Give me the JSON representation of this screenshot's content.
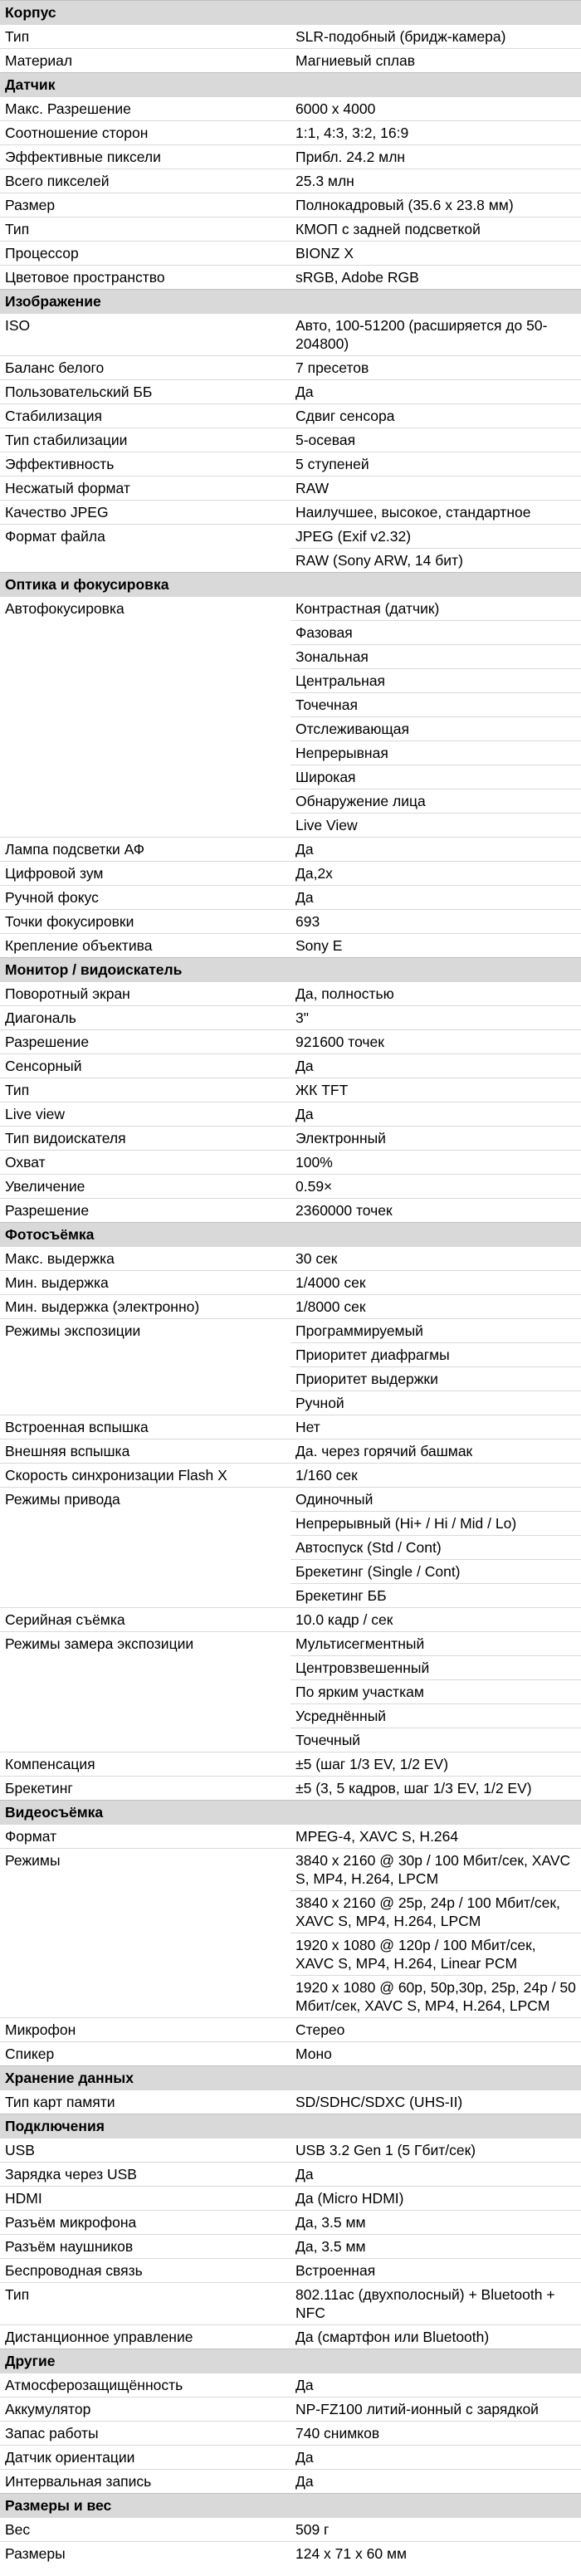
{
  "sections": [
    {
      "title": "Корпус",
      "rows": [
        {
          "label": "Тип",
          "value": "SLR-подобный (бридж-камера)"
        },
        {
          "label": "Материал",
          "value": "Магниевый сплав"
        }
      ]
    },
    {
      "title": "Датчик",
      "rows": [
        {
          "label": "Макс. Разрешение",
          "value": "6000 x 4000"
        },
        {
          "label": "Соотношение сторон",
          "value": "1:1, 4:3, 3:2, 16:9"
        },
        {
          "label": "Эффективные пиксели",
          "value": "Прибл. 24.2 млн"
        },
        {
          "label": "Всего пикселей",
          "value": "25.3 млн"
        },
        {
          "label": "Размер",
          "value": "Полнокадровый (35.6 x 23.8 мм)"
        },
        {
          "label": "Тип",
          "value": "КМОП с задней подсветкой"
        },
        {
          "label": "Процессор",
          "value": "BIONZ X"
        },
        {
          "label": "Цветовое пространство",
          "value": "sRGB, Adobe RGB"
        }
      ]
    },
    {
      "title": "Изображение",
      "rows": [
        {
          "label": "ISO",
          "value": "Авто, 100-51200 (расширяется до 50-204800)"
        },
        {
          "label": "Баланс белого",
          "value": "7 пресетов"
        },
        {
          "label": "Пользовательский ББ",
          "value": "Да"
        },
        {
          "label": "Стабилизация",
          "value": "Сдвиг сенсора"
        },
        {
          "label": "Тип стабилизации",
          "value": "5-осевая"
        },
        {
          "label": "Эффективность",
          "value": "5 ступеней"
        },
        {
          "label": "Несжатый формат",
          "value": "RAW"
        },
        {
          "label": "Качество JPEG",
          "value": "Наилучшее, высокое, стандартное"
        },
        {
          "label": "Формат файла",
          "value": "JPEG (Exif v2.32)"
        },
        {
          "label": "",
          "value": "RAW (Sony ARW, 14 бит)"
        }
      ]
    },
    {
      "title": "Оптика и фокусировка",
      "rows": [
        {
          "label": "Автофокусировка",
          "value": "Контрастная (датчик)"
        },
        {
          "label": "",
          "value": "Фазовая"
        },
        {
          "label": "",
          "value": "Зональная"
        },
        {
          "label": "",
          "value": "Центральная"
        },
        {
          "label": "",
          "value": "Точечная"
        },
        {
          "label": "",
          "value": "Отслеживающая"
        },
        {
          "label": "",
          "value": "Непрерывная"
        },
        {
          "label": "",
          "value": "Широкая"
        },
        {
          "label": "",
          "value": "Обнаружение лица"
        },
        {
          "label": "",
          "value": "Live View"
        },
        {
          "label": "Лампа подсветки АФ",
          "value": "Да"
        },
        {
          "label": "Цифровой зум",
          "value": "Да,2x"
        },
        {
          "label": "Ручной фокус",
          "value": "Да"
        },
        {
          "label": "Точки фокусировки",
          "value": "693"
        },
        {
          "label": "Крепление объектива",
          "value": "Sony E"
        }
      ]
    },
    {
      "title": "Монитор / видоискатель",
      "rows": [
        {
          "label": "Поворотный экран",
          "value": "Да, полностью"
        },
        {
          "label": "Диагональ",
          "value": "3\""
        },
        {
          "label": "Разрешение",
          "value": "921600 точек"
        },
        {
          "label": "Сенсорный",
          "value": "Да"
        },
        {
          "label": "Тип",
          "value": "ЖК TFT"
        },
        {
          "label": "Live view",
          "value": "Да"
        },
        {
          "label": "Тип видоискателя",
          "value": "Электронный"
        },
        {
          "label": "Охват",
          "value": "100%"
        },
        {
          "label": "Увеличение",
          "value": "0.59×"
        },
        {
          "label": "Разрешение",
          "value": "2360000 точек"
        }
      ]
    },
    {
      "title": "Фотосъёмка",
      "rows": [
        {
          "label": "Макс. выдержка",
          "value": "30 сек"
        },
        {
          "label": "Мин. выдержка",
          "value": "1/4000 сек"
        },
        {
          "label": "Мин. выдержка (электронно)",
          "value": "1/8000 сек"
        },
        {
          "label": "Режимы экспозиции",
          "value": "Программируемый"
        },
        {
          "label": "",
          "value": "Приоритет диафрагмы"
        },
        {
          "label": "",
          "value": "Приоритет выдержки"
        },
        {
          "label": "",
          "value": "Ручной"
        },
        {
          "label": "Встроенная вспышка",
          "value": "Нет"
        },
        {
          "label": "Внешняя вспышка",
          "value": "Да. через горячий башмак"
        },
        {
          "label": "Скорость синхронизации Flash X",
          "value": "1/160 сек"
        },
        {
          "label": "Режимы привода",
          "value": "Одиночный"
        },
        {
          "label": "",
          "value": "Непрерывный (Hi+ / Hi / Mid / Lo)"
        },
        {
          "label": "",
          "value": "Автоспуск (Std / Cont)"
        },
        {
          "label": "",
          "value": "Брекетинг (Single / Cont)"
        },
        {
          "label": "",
          "value": "Брекетинг ББ"
        },
        {
          "label": "Серийная съёмка",
          "value": "10.0 кадр / сек"
        },
        {
          "label": "Режимы замера экспозиции",
          "value": "Мультисегментный"
        },
        {
          "label": "",
          "value": "Центровзвешенный"
        },
        {
          "label": "",
          "value": "По ярким участкам"
        },
        {
          "label": "",
          "value": "Усреднённый"
        },
        {
          "label": "",
          "value": "Точечный"
        },
        {
          "label": "Компенсация",
          "value": "±5 (шаг 1/3 EV, 1/2 EV)"
        },
        {
          "label": "Брекетинг",
          "value": "±5 (3, 5 кадров, шаг 1/3 EV, 1/2 EV)"
        }
      ]
    },
    {
      "title": "Видеосъёмка",
      "rows": [
        {
          "label": "Формат",
          "value": "MPEG-4, XAVC S, H.264"
        },
        {
          "label": "Режимы",
          "value": "3840 x 2160 @ 30p / 100 Мбит/сек, XAVC S, MP4, H.264, LPCM"
        },
        {
          "label": "",
          "value": "3840 x 2160 @ 25p, 24p / 100 Мбит/сек, XAVC S, MP4, H.264, LPCM"
        },
        {
          "label": "",
          "value": "1920 x 1080 @ 120p / 100 Мбит/сек, XAVC S, MP4, H.264, Linear PCM"
        },
        {
          "label": "",
          "value": "1920 x 1080 @ 60p, 50p,30p, 25p, 24p / 50 Мбит/сек, XAVC S, MP4, H.264, LPCM"
        },
        {
          "label": "Микрофон",
          "value": "Стерео"
        },
        {
          "label": "Спикер",
          "value": "Моно"
        }
      ]
    },
    {
      "title": "Хранение данных",
      "rows": [
        {
          "label": "Тип карт памяти",
          "value": "SD/SDHC/SDXC (UHS-II)"
        }
      ]
    },
    {
      "title": "Подключения",
      "rows": [
        {
          "label": "USB",
          "value": "USB 3.2 Gen 1 (5 Гбит/сек)"
        },
        {
          "label": "Зарядка через USB",
          "value": "Да"
        },
        {
          "label": "HDMI",
          "value": "Да (Micro HDMI)"
        },
        {
          "label": "Разъём микрофона",
          "value": "Да, 3.5 мм"
        },
        {
          "label": "Разъём наушников",
          "value": "Да, 3.5 мм"
        },
        {
          "label": "Беспроводная связь",
          "value": "Встроенная"
        },
        {
          "label": "Тип",
          "value": "802.11ac (двухполосный) + Bluetooth + NFC"
        },
        {
          "label": "Дистанционное управление",
          "value": "Да (смартфон или Bluetooth)"
        }
      ]
    },
    {
      "title": "Другие",
      "rows": [
        {
          "label": "Атмосферозащищённость",
          "value": "Да"
        },
        {
          "label": "Аккумулятор",
          "value": "NP-FZ100 литий-ионный с зарядкой"
        },
        {
          "label": "Запас работы",
          "value": "740 снимков"
        },
        {
          "label": "Датчик ориентации",
          "value": "Да"
        },
        {
          "label": "Интервальная запись",
          "value": "Да"
        }
      ]
    },
    {
      "title": "Размеры и вес",
      "rows": [
        {
          "label": "Вес",
          "value": "509 г"
        },
        {
          "label": "Размеры",
          "value": "124 x 71 x 60 мм"
        }
      ]
    }
  ]
}
